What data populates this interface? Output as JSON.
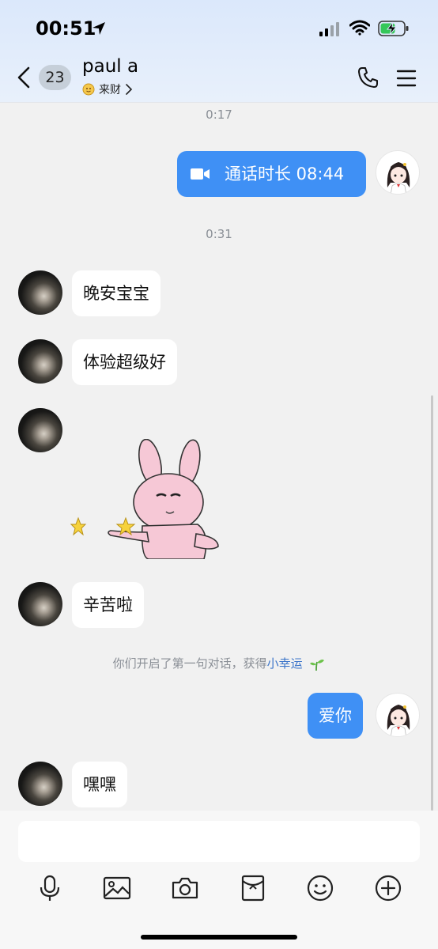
{
  "status_bar": {
    "time": "00:51"
  },
  "header": {
    "back_label": "<",
    "unread_count": "23",
    "contact_name": "paul a",
    "contact_subtitle": "来财",
    "subtitle_chevron": ">",
    "icons": [
      "location-arrow-icon",
      "signal-icon",
      "wifi-icon",
      "battery-charging-icon",
      "back-chevron-icon",
      "phone-icon",
      "menu-icon"
    ]
  },
  "chat": {
    "time_1": "0:17",
    "call_record": "通话时长 08:44",
    "time_2": "0:31",
    "messages": [
      {
        "text": "晚安宝宝"
      },
      {
        "text": "体验超级好"
      },
      {
        "text": "辛苦啦"
      }
    ],
    "notice_text": "你们开启了第一句对话，获得",
    "notice_link": "小幸运",
    "self_message": "爱你",
    "last_message": "嘿嘿"
  },
  "toolbar": {
    "icons": [
      "microphone-icon",
      "image-icon",
      "camera-icon",
      "red-packet-icon",
      "emoji-icon",
      "plus-icon"
    ]
  },
  "colors": {
    "header_bg": "#dbe8fb",
    "outgoing_bubble": "#3f90f5",
    "incoming_bubble": "#ffffff",
    "chat_bg": "#f1f1f1",
    "link": "#3b74c9"
  }
}
